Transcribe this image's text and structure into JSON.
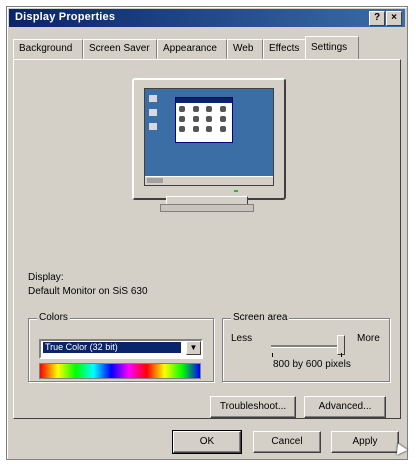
{
  "window": {
    "title": "Display Properties",
    "help_label": "?",
    "close_label": "×"
  },
  "tabs": [
    {
      "label": "Background"
    },
    {
      "label": "Screen Saver"
    },
    {
      "label": "Appearance"
    },
    {
      "label": "Web"
    },
    {
      "label": "Effects"
    },
    {
      "label": "Settings"
    }
  ],
  "active_tab": "Settings",
  "display": {
    "label": "Display:",
    "value": "Default Monitor on SiS 630"
  },
  "colors": {
    "group_label": "Colors",
    "selected": "True Color (32 bit)",
    "arrow_label": "▼"
  },
  "screen_area": {
    "group_label": "Screen area",
    "less_label": "Less",
    "more_label": "More",
    "resolution": "800 by 600 pixels",
    "slider_level": 1.0
  },
  "buttons": {
    "troubleshoot": "Troubleshoot...",
    "advanced": "Advanced...",
    "ok": "OK",
    "cancel": "Cancel",
    "apply": "Apply"
  },
  "icons": {
    "monitor": "monitor-preview-icon",
    "cursor": "mouse-pointer-icon"
  }
}
